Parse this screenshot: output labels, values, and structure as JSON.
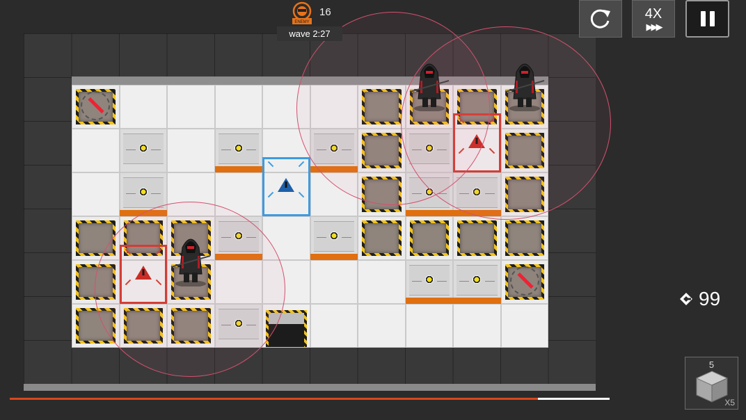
{
  "hud": {
    "enemy_icon": "enemy-counter-icon",
    "enemy_icon_text": "ENEMY",
    "enemy_count": "16",
    "wave_text": "wave 2:27"
  },
  "controls": {
    "restart_icon": "restart-icon",
    "speed_label": "4X",
    "speed_arrows": "▶▶▶",
    "pause_icon": "pause-icon"
  },
  "deploy_points": {
    "icon": "cost-icon",
    "value": "99"
  },
  "deploy_card": {
    "icon": "cube-icon",
    "cost": "5",
    "count": "X5"
  },
  "wave_progress": 0.88,
  "colors": {
    "progress_fill": "#d9461e",
    "danger_marker": "#d23a2f",
    "friendly_marker": "#3d9be0",
    "stripe": "#e06f0f",
    "range": "#d4506f"
  },
  "board": {
    "cols": 10,
    "rows": 6,
    "tiles": [
      [
        "node",
        "floor",
        "floor",
        "floor",
        "floor",
        "floor",
        "hazard",
        "hazard",
        "hazard",
        "hazard"
      ],
      [
        "floor",
        "metal-n",
        "floor",
        "metal",
        "floor",
        "metal",
        "hazard",
        "metal-n",
        "floor",
        "hazard"
      ],
      [
        "floor",
        "metal",
        "floor",
        "floor",
        "floor",
        "floor",
        "hazard",
        "metal",
        "metal",
        "hazard"
      ],
      [
        "hazard",
        "hazard",
        "hazard",
        "metal",
        "floor",
        "metal",
        "hazard",
        "hazard",
        "hazard",
        "hazard"
      ],
      [
        "hazard",
        "floor",
        "hazard",
        "floor",
        "floor",
        "floor",
        "floor",
        "metal",
        "metal",
        "node"
      ],
      [
        "hazard",
        "hazard",
        "hazard",
        "metal-n",
        "stair",
        "floor",
        "floor",
        "floor",
        "floor",
        "floor"
      ]
    ]
  },
  "markers": [
    {
      "type": "danger",
      "col": 1,
      "row": 4,
      "icon": "warning-icon"
    },
    {
      "type": "danger",
      "col": 8,
      "row": 1,
      "icon": "warning-icon"
    },
    {
      "type": "friendly",
      "col": 4,
      "row": 2,
      "icon": "warning-icon"
    }
  ],
  "enemies": [
    {
      "name": "hooded-gunner-1",
      "col": 7,
      "row": 0
    },
    {
      "name": "hooded-gunner-2",
      "col": 9,
      "row": 0
    },
    {
      "name": "hooded-caster",
      "col": 2,
      "row": 4
    }
  ]
}
